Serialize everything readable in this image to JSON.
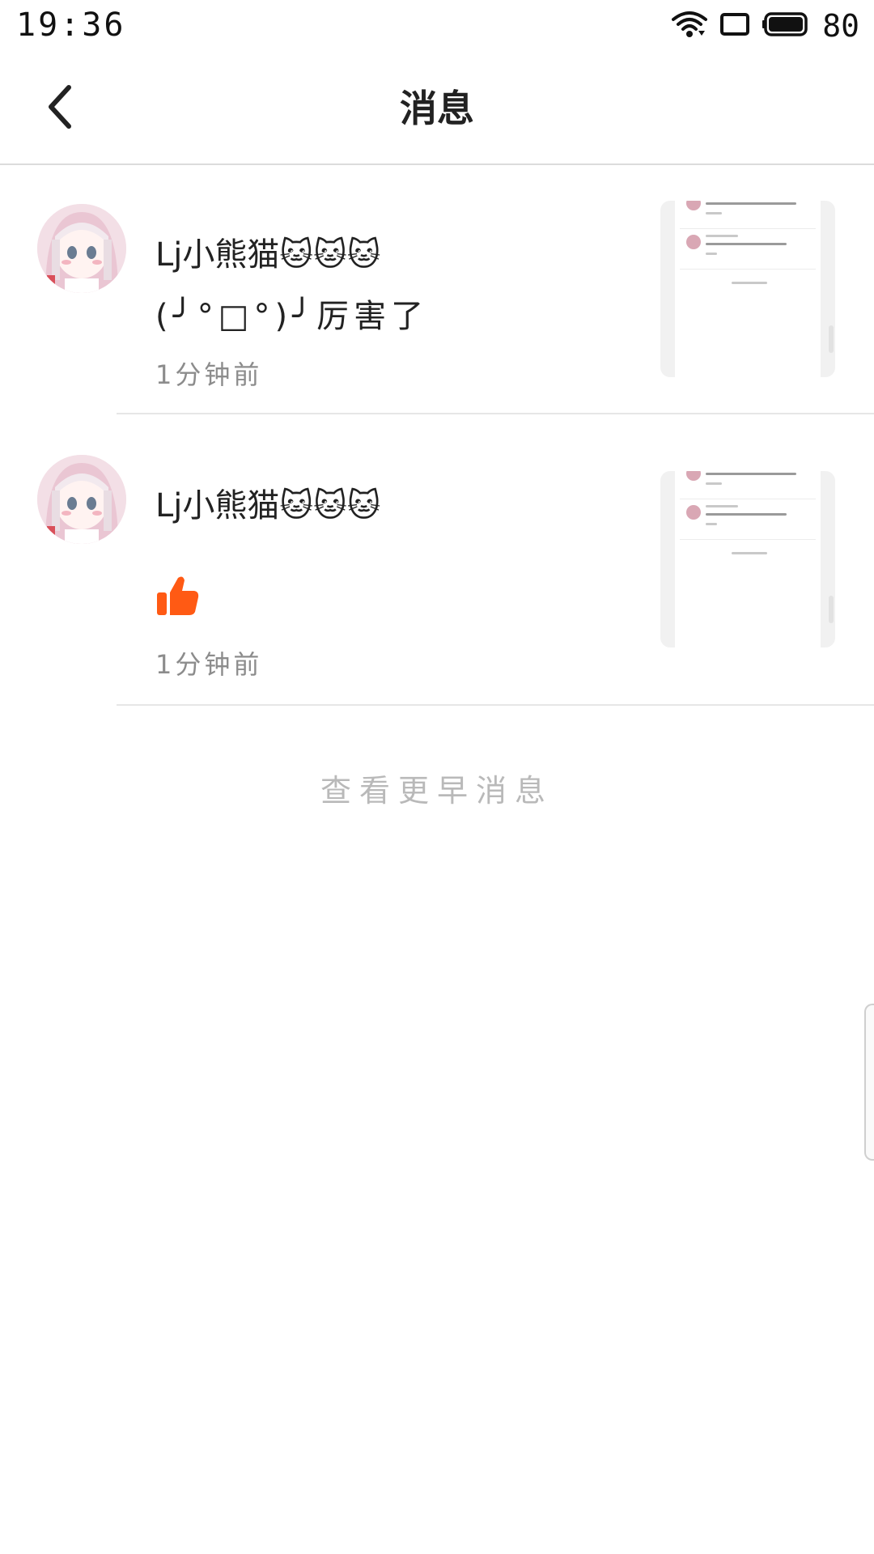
{
  "status_bar": {
    "time": "19:36",
    "battery_level": "80",
    "icons": [
      "wifi-icon",
      "screen-rotate-icon",
      "battery-icon"
    ]
  },
  "header": {
    "back_icon": "chevron-left-icon",
    "title": "消息"
  },
  "messages": [
    {
      "name": "Lj小熊猫🐱🐱🐱",
      "content": "(╯°□°)╯厉害了",
      "time": "1分钟前",
      "avatar": "anime-girl-avatar",
      "has_thumbnail": true
    },
    {
      "name": "Lj小熊猫🐱🐱🐱",
      "content_icon": "thumbs-up-icon",
      "time": "1分钟前",
      "avatar": "anime-girl-avatar",
      "has_thumbnail": true
    }
  ],
  "footer": {
    "more_label": "查看更早消息"
  },
  "colors": {
    "like_orange": "#ff5a14",
    "divider": "#e6e6e6",
    "muted_text": "#8c8c8c"
  }
}
